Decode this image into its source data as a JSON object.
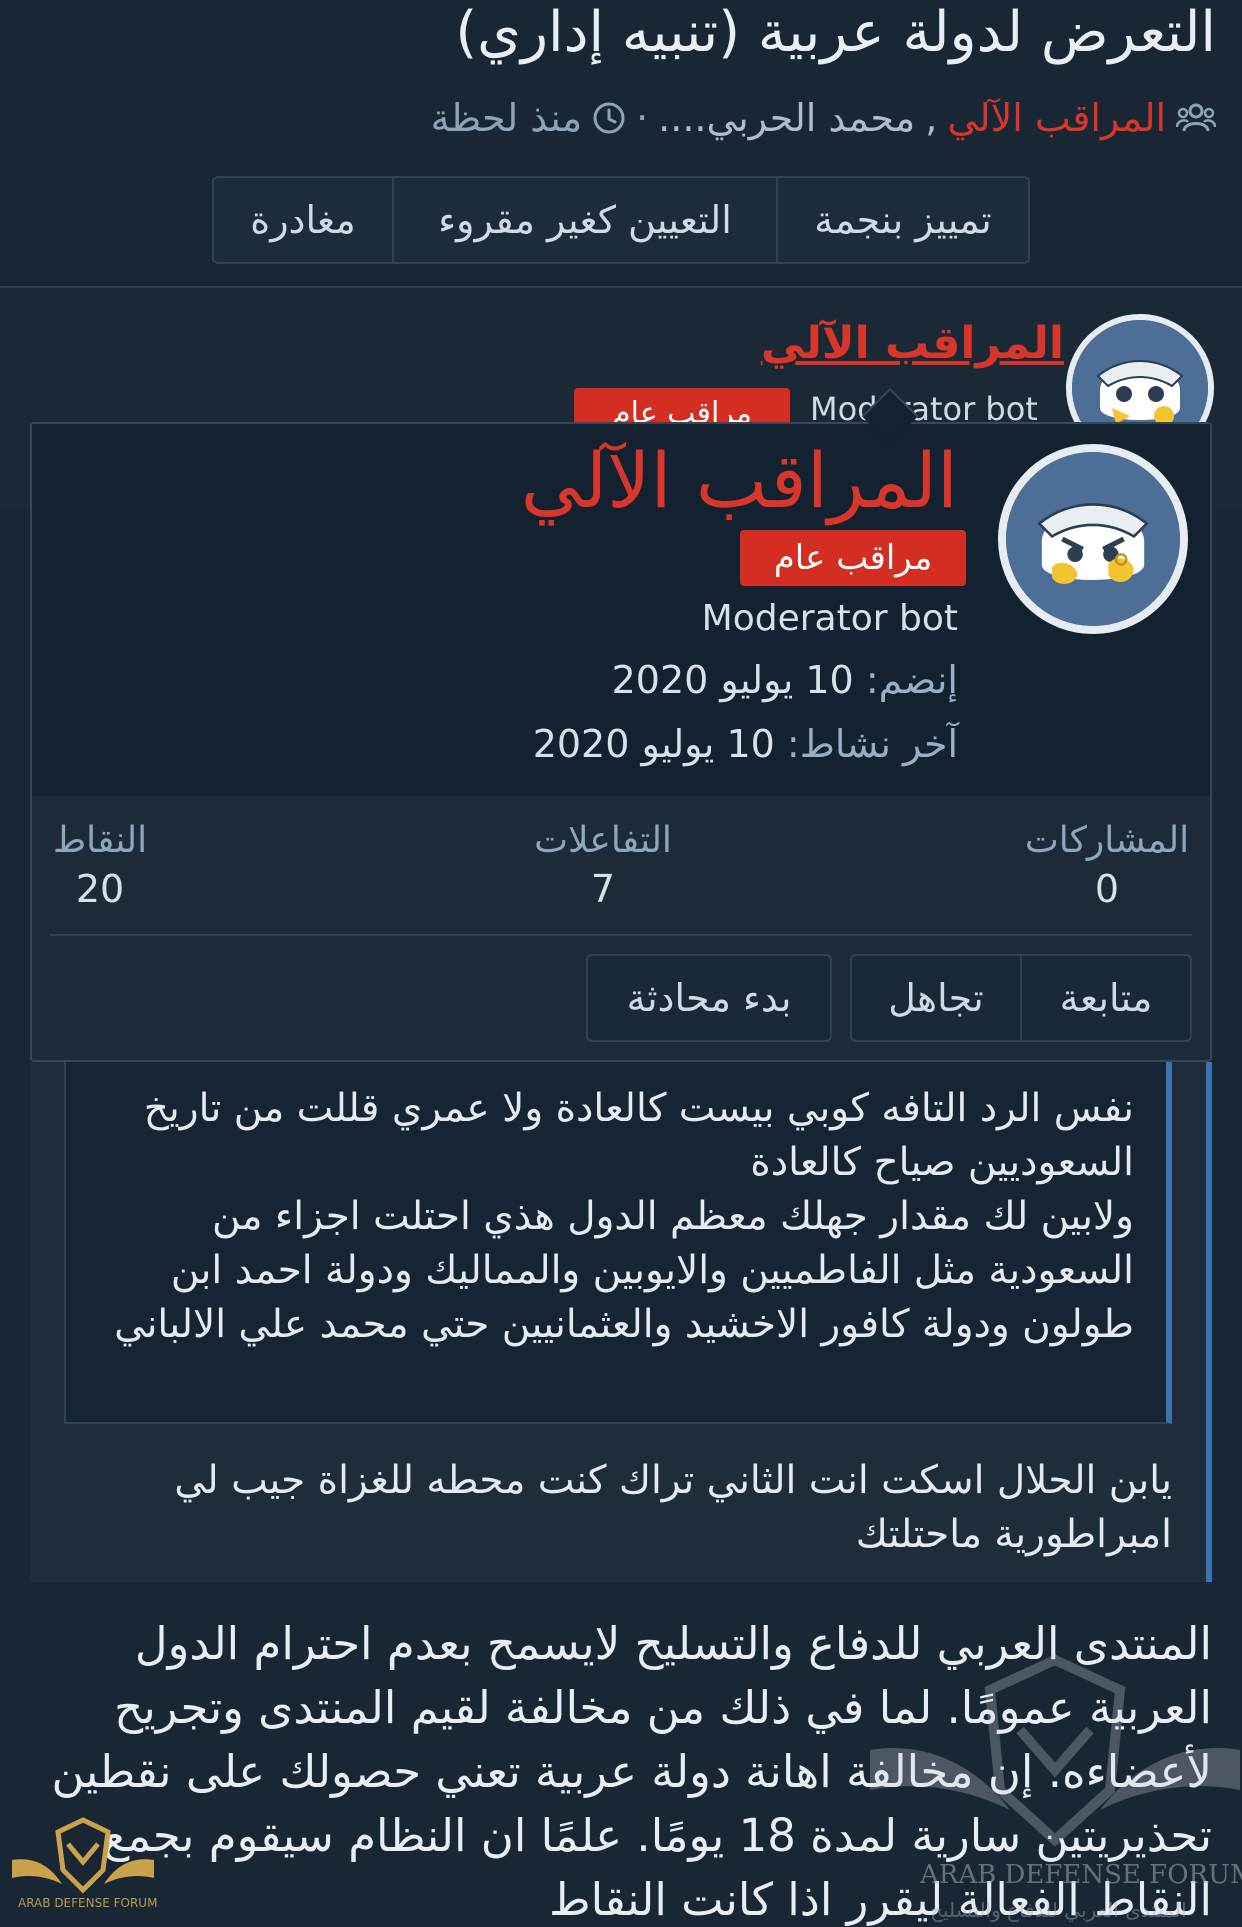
{
  "thread": {
    "title": "التعرض لدولة عربية (تنبيه إداري)",
    "starter": "المراقب الآلي",
    "participant": "محمد الحربي....",
    "separator": "·",
    "time": "منذ لحظة"
  },
  "actions": {
    "star": "تمييز بنجمة",
    "mark_unread": "التعيين كغير مقروء",
    "leave": "مغادرة"
  },
  "post": {
    "username": "المراقب الآلي",
    "user_title": "Moderator bot",
    "badge": "مراقب عام"
  },
  "member_card": {
    "name": "المراقب الآلي",
    "badge": "مراقب عام",
    "user_title": "Moderator bot",
    "joined_label": "إنضم:",
    "joined_value": "10 يوليو 2020",
    "last_seen_label": "آخر نشاط:",
    "last_seen_value": "10 يوليو 2020",
    "stats": {
      "messages_label": "المشاركات",
      "messages_value": "0",
      "reactions_label": "التفاعلات",
      "reactions_value": "7",
      "points_label": "النقاط",
      "points_value": "20"
    },
    "follow": "متابعة",
    "ignore": "تجاهل",
    "start_conversation": "بدء محادثة"
  },
  "quote": {
    "text": "نفس الرد التافه كوبي بيست كالعادة ولا عمري قللت من تاريخ السعوديين صياح كالعادة\nولابين لك مقدار جهلك معظم الدول هذي احتلت اجزاء من السعودية مثل الفاطميين والايوبين والمماليك ودولة احمد ابن طولون ودولة كافور الاخشيد والعثمانيين حتي محمد علي الالباني"
  },
  "reply": {
    "text": "يابن الحلال اسكت انت الثاني تراك كنت محطه للغزاة جيب لي امبراطورية ماحتلتك"
  },
  "notice": {
    "text": "المنتدى العربي للدفاع والتسليح لايسمح بعدم احترام الدول العربية عمومًا. لما في ذلك من مخالفة لقيم المنتدى وتجريح لأعضاءه. إن مخالفة اهانة دولة عربية تعني حصولك على نقطين تحذيريتين سارية لمدة 18 يومًا. علمًا ان النظام سيقوم بجمع النقاط الفعالة ليقرر اذا كانت النقاط"
  },
  "watermark": {
    "text": "ARAB DEFENSE FORUM",
    "sub": "المنتدى العربي للدفاع والتسليح",
    "logo_text": "ARAB DEFENSE FORUM"
  },
  "colors": {
    "background": "#192634",
    "accent_red": "#d9362b",
    "quote_bar": "#3a73b0"
  },
  "icons": {
    "participants": "users-icon",
    "time": "clock-icon"
  }
}
